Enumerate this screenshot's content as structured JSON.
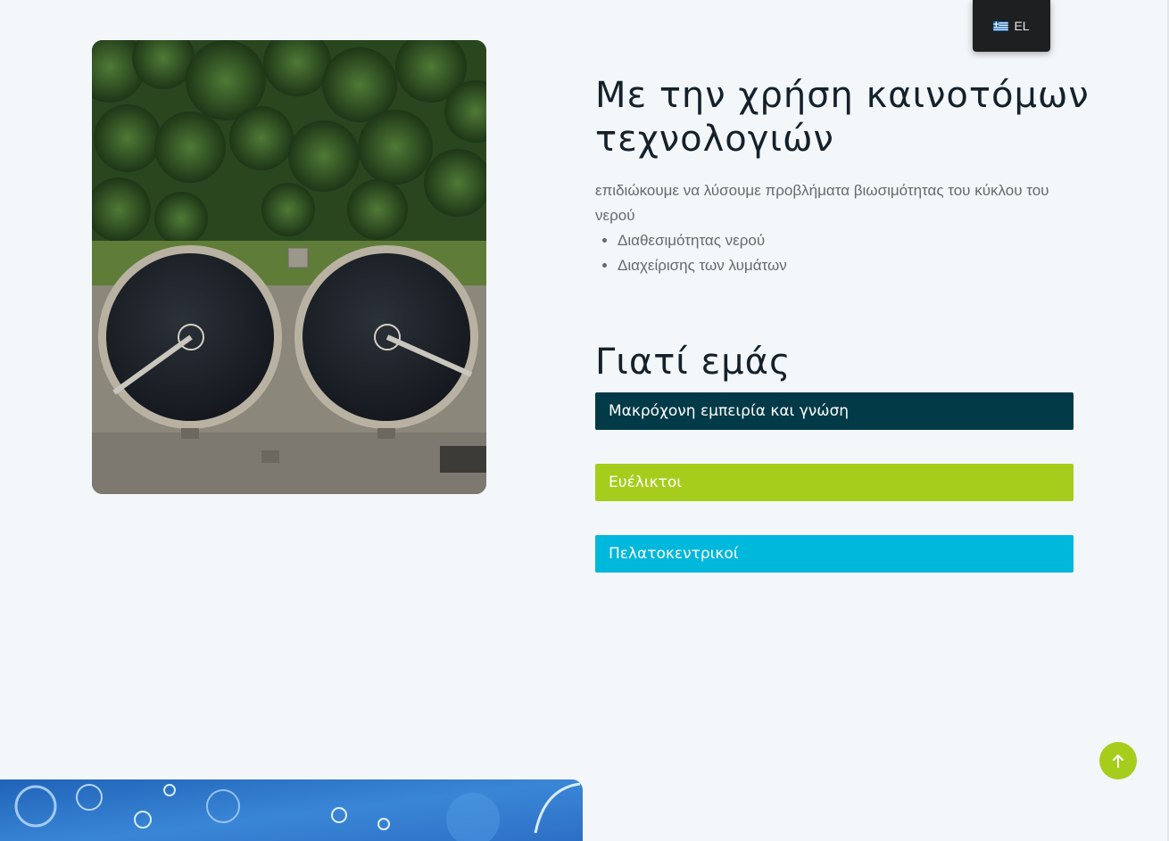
{
  "language_switcher": {
    "code": "EL",
    "flag_icon": "greek-flag-icon"
  },
  "hero_image": {
    "subject": "aerial view of two circular wastewater treatment tanks among trees"
  },
  "intro": {
    "heading": "Με την χρήση καινοτόμων τεχνολογιών",
    "text": "επιδιώκουμε να λύσουμε προβλήματα βιωσιμότητας του κύκλου του νερού",
    "bullets": [
      "Διαθεσιμότητας νερού",
      "Διαχείρισης των λυμάτων"
    ]
  },
  "why_us": {
    "heading": "Γιατί εμάς",
    "items": [
      {
        "label": "Μακρόχονη εμπειρία και γνώση",
        "color": "#023a48"
      },
      {
        "label": "Ευέλικτοι",
        "color": "#a6cd1c"
      },
      {
        "label": "Πελατοκεντρικοί",
        "color": "#00b7dc"
      }
    ]
  },
  "scroll_top": {
    "icon": "arrow-up-icon",
    "color": "#a6cd1c"
  },
  "bottom_image": {
    "subject": "blue water with bubbles"
  }
}
